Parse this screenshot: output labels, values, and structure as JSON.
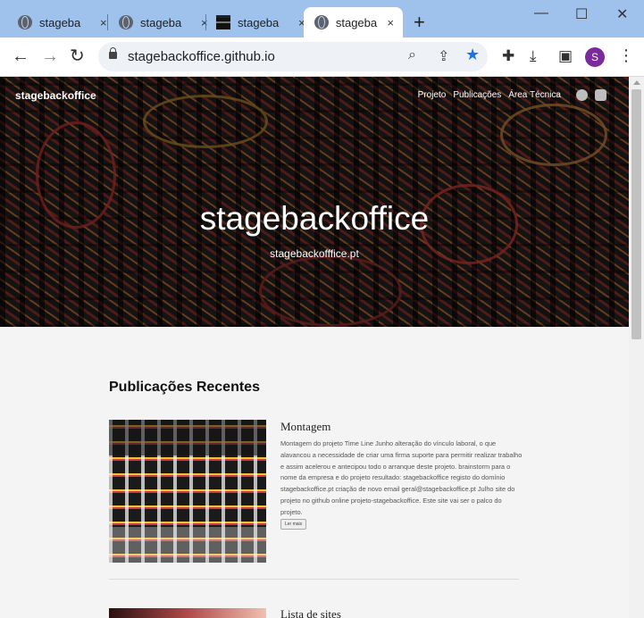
{
  "browser": {
    "tabs": [
      {
        "title": "stageba",
        "close": "×"
      },
      {
        "title": "stageba",
        "close": "×"
      },
      {
        "title": "stageba",
        "close": "×"
      },
      {
        "title": "stageba",
        "close": "×"
      }
    ],
    "new_tab": "+",
    "window_controls": {
      "minimize": "—",
      "maximize": "☐",
      "close": "✕"
    },
    "url": "stagebackoffice.github.io",
    "profile_initial": "S"
  },
  "site": {
    "brand": "stagebackoffice",
    "nav": [
      "Projeto",
      "Publicações",
      "Área Técnica"
    ],
    "social_icons": [
      "github-icon",
      "instagram-icon"
    ],
    "hero_title": "stagebackoffice",
    "hero_subtitle": "stagebackofffice.pt"
  },
  "main": {
    "section_title": "Publicações Recentes",
    "posts": [
      {
        "title": "Montagem",
        "excerpt": "Montagem do projeto Time Line Junho alteração do vínculo laboral, o que alavancou a necessidade de criar uma firma suporte para permitir realizar trabalho e assim acelerou e antecipou todo o arranque deste projeto. brainstorm para o nome da empresa e do projeto resultado: stagebackoffice registo do domínio stagebackoffice.pt criação de novo email geral@stagebackoffice.pt Julho site do projeto no github online projeto-stagebackoffice. Este site vai ser o palco do projeto.",
        "read_more": "Ler mais"
      },
      {
        "title": "Lista de sites"
      }
    ]
  },
  "colors": {
    "tabbar": "#9ec2eb",
    "star": "#1a73e8",
    "avatar": "#7b2a9e",
    "page_bg": "#f4f4f4"
  }
}
